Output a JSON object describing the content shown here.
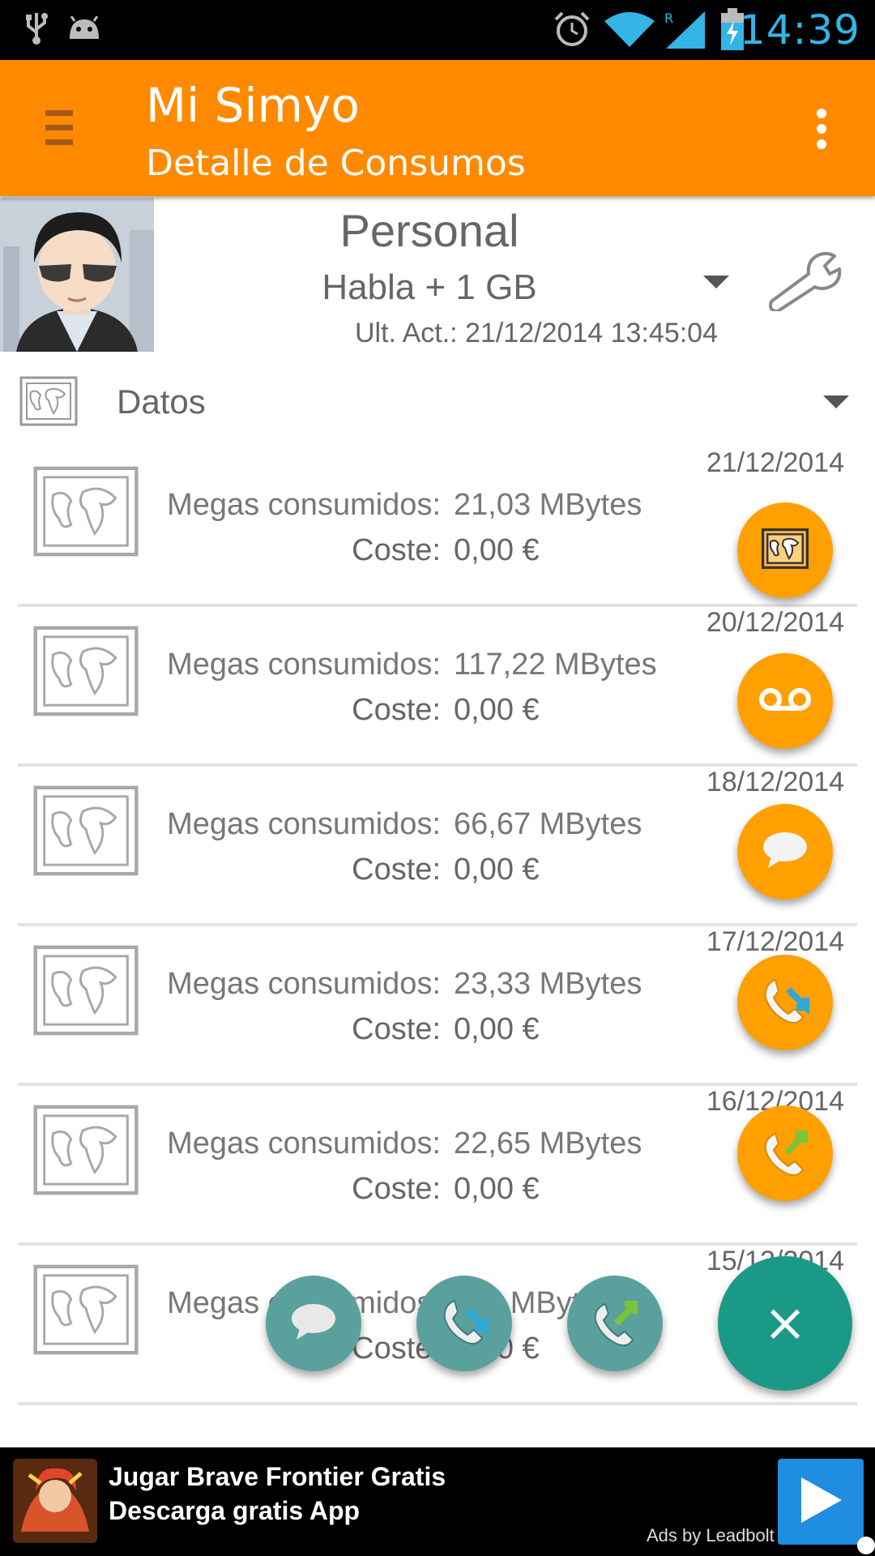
{
  "status_bar": {
    "time": "14:39",
    "icons": [
      "usb-icon",
      "android-debug-icon",
      "alarm-icon",
      "wifi-icon",
      "signal-roaming-icon",
      "battery-charging-icon"
    ],
    "roaming_indicator": "R"
  },
  "app_bar": {
    "title": "Mi Simyo",
    "subtitle": "Detalle de Consumos",
    "accent_color": "#ff8a00"
  },
  "profile": {
    "name": "Personal",
    "plan": "Habla + 1 GB",
    "updated": "Ult. Act.: 21/12/2014 13:45:04"
  },
  "section": {
    "label": "Datos"
  },
  "consumption": {
    "items": [
      {
        "date": "21/12/2014",
        "label": "Megas consumidos:",
        "value": "21,03 MBytes",
        "cost_label": "Coste:",
        "cost": "0,00 €"
      },
      {
        "date": "20/12/2014",
        "label": "Megas consumidos:",
        "value": "117,22 MBytes",
        "cost_label": "Coste:",
        "cost": "0,00 €"
      },
      {
        "date": "18/12/2014",
        "label": "Megas consumidos:",
        "value": "66,67 MBytes",
        "cost_label": "Coste:",
        "cost": "0,00 €"
      },
      {
        "date": "17/12/2014",
        "label": "Megas consumidos:",
        "value": "23,33 MBytes",
        "cost_label": "Coste:",
        "cost": "0,00 €"
      },
      {
        "date": "16/12/2014",
        "label": "Megas consumidos:",
        "value": "22,65 MBytes",
        "cost_label": "Coste:",
        "cost": "0,00 €"
      },
      {
        "date": "15/12/2014",
        "label": "Megas consumidos:",
        "value": "…1 MBytes",
        "cost_label": "Coste:",
        "cost": "0,00 €"
      }
    ]
  },
  "fab_menu": {
    "main_label": "×",
    "orange_actions": [
      "data-map-icon",
      "voicemail-icon",
      "sms-bubble-icon",
      "incoming-call-icon",
      "outgoing-call-icon"
    ],
    "teal_actions": [
      "sms-bubble-icon",
      "incoming-call-icon",
      "outgoing-call-icon"
    ],
    "orange_color": "#ffa000",
    "teal_color": "#5aa19e",
    "main_color": "#1a9a86"
  },
  "ad": {
    "title": "Jugar Brave Frontier Gratis",
    "subtitle": "Descarga gratis App",
    "provider": "Ads by Leadbolt"
  }
}
